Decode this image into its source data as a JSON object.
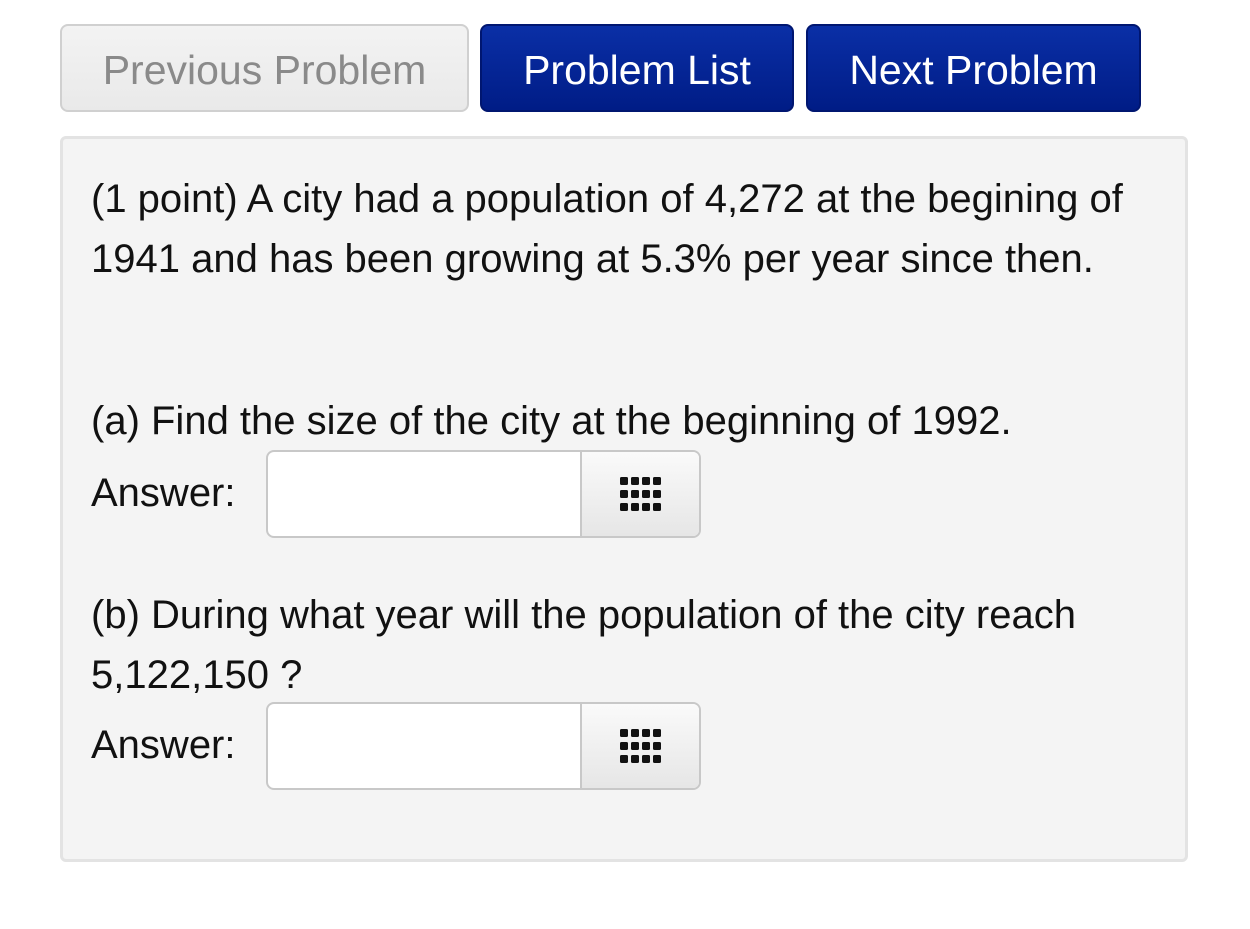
{
  "nav": {
    "previous_label": "Previous Problem",
    "list_label": "Problem List",
    "next_label": "Next Problem"
  },
  "problem": {
    "intro": "(1 point) A city had a population of 4,272 at the begining of 1941 and has been growing at 5.3% per year since then.",
    "part_a": {
      "question": "(a) Find the size of the city at the beginning of 1992.",
      "answer_label": "Answer:",
      "value": "",
      "keypad_icon": "keypad-grid-icon"
    },
    "part_b": {
      "question": "(b) During what year will the population of the city reach 5,122,150 ?",
      "answer_label": "Answer:",
      "value": "",
      "keypad_icon": "keypad-grid-icon"
    }
  },
  "colors": {
    "primary": "#001c86",
    "panel": "#f4f4f4",
    "disabled_text": "#8a8a8a"
  }
}
